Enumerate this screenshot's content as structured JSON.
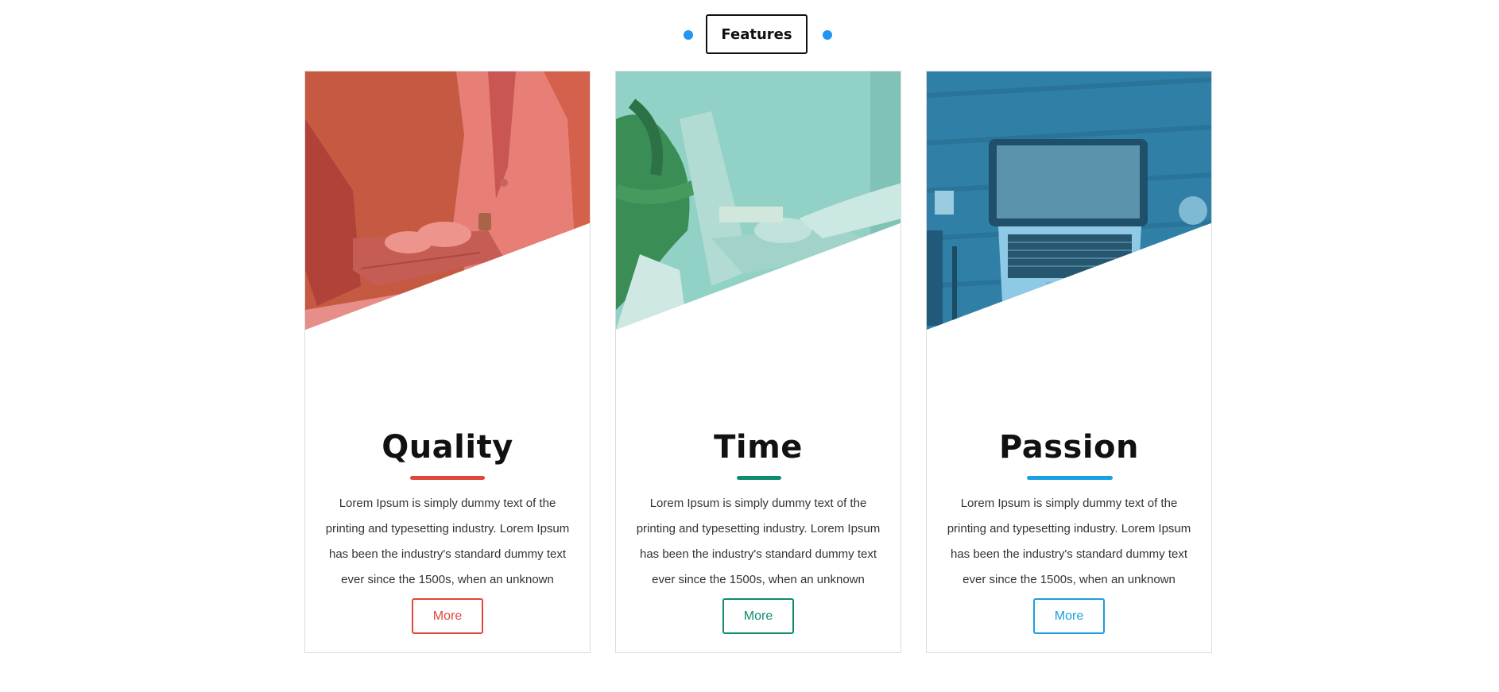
{
  "section": {
    "heading": "Features",
    "dot_color": "#2196f3"
  },
  "cards": [
    {
      "title": "Quality",
      "text": "Lorem Ipsum is simply dummy text of the printing and typesetting industry. Lorem Ipsum has been the industry's standard dummy text ever since the 1500s, when an unknown",
      "button_label": "More",
      "accent_color": "#e0463a",
      "image": "woman-typing-on-laptop-photo"
    },
    {
      "title": "Time",
      "text": "Lorem Ipsum is simply dummy text of the printing and typesetting industry. Lorem Ipsum has been the industry's standard dummy text ever since the 1500s, when an unknown",
      "button_label": "More",
      "accent_color": "#0e8c6e",
      "image": "hands-on-laptop-with-plant-photo"
    },
    {
      "title": "Passion",
      "text": "Lorem Ipsum is simply dummy text of the printing and typesetting industry. Lorem Ipsum has been the industry's standard dummy text ever since the 1500s, when an unknown",
      "button_label": "More",
      "accent_color": "#1a9fe0",
      "image": "laptop-on-wooden-desk-photo"
    }
  ]
}
